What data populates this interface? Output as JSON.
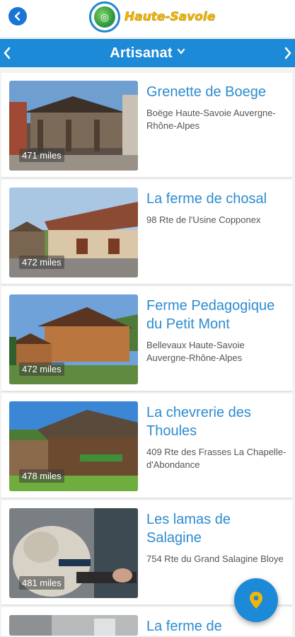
{
  "header": {
    "logo_text": "Haute-Savoie"
  },
  "category": {
    "title": "Artisanat"
  },
  "items": [
    {
      "title": "Grenette de Boege",
      "address": "Boëge Haute-Savoie Auvergne-Rhône-Alpes",
      "distance": "471 miles"
    },
    {
      "title": "La ferme de chosal",
      "address": "98 Rte de l'Usine Copponex",
      "distance": "472 miles"
    },
    {
      "title": "Ferme Pedagogique du Petit Mont",
      "address": "Bellevaux Haute-Savoie Auvergne-Rhône-Alpes",
      "distance": "472 miles"
    },
    {
      "title": "La chevrerie des Thoules",
      "address": "409 Rte des Frasses La Chapelle-d'Abondance",
      "distance": "478 miles"
    },
    {
      "title": "Les lamas de Salagine",
      "address": "754 Rte du Grand Salagine Bloye",
      "distance": "481 miles"
    },
    {
      "title": "La ferme de",
      "address": "",
      "distance": ""
    }
  ],
  "colors": {
    "accent": "#1c8ad6",
    "title": "#2c8ccf",
    "logo": "#f2b705"
  },
  "icons": {
    "back": "back-arrow-icon",
    "fab": "map-pin-icon"
  }
}
